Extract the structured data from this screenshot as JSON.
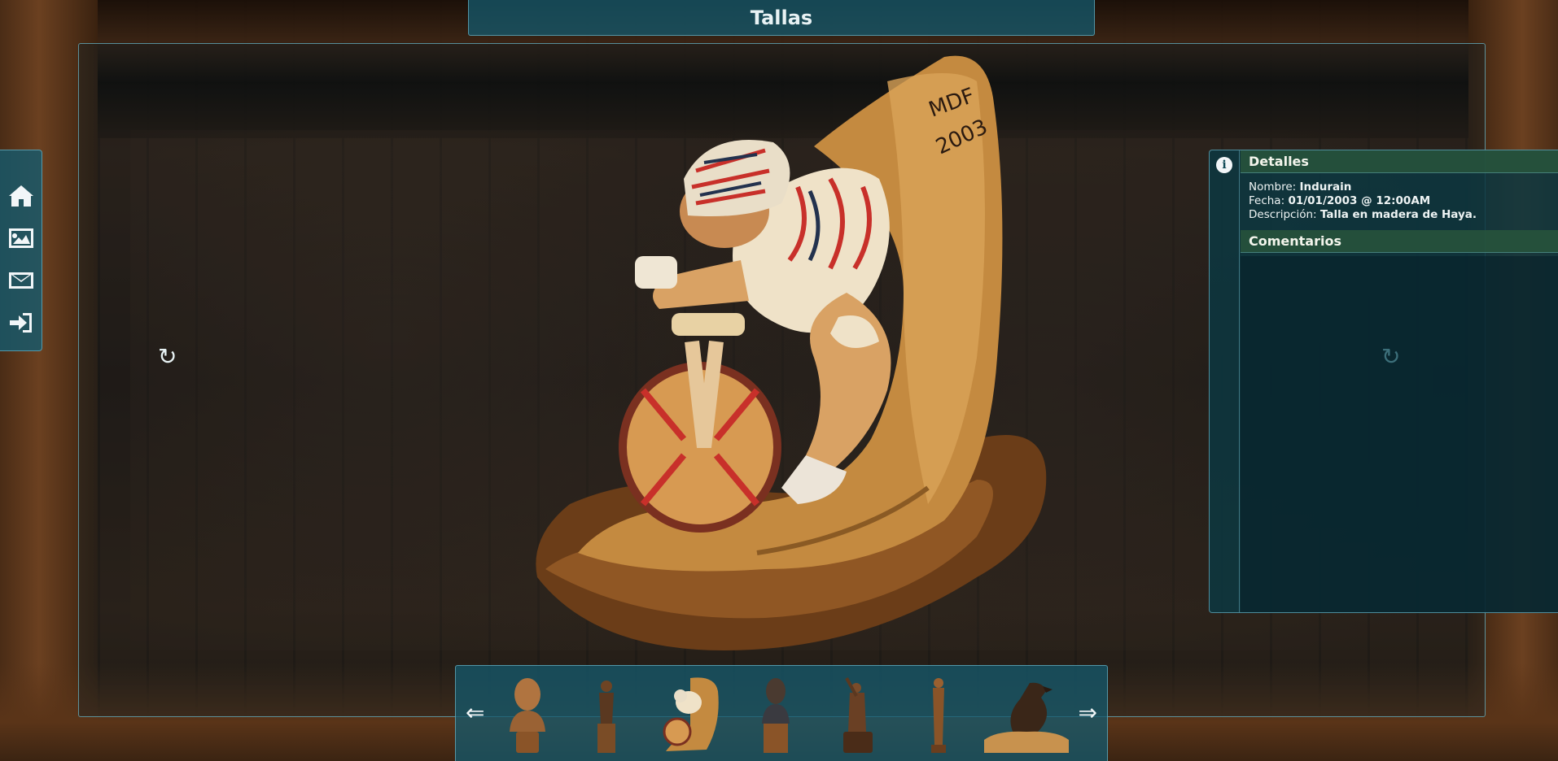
{
  "header": {
    "title": "Tallas"
  },
  "nav": {
    "items": [
      {
        "icon": "home-icon",
        "label": ""
      },
      {
        "icon": "image-icon",
        "label": ""
      },
      {
        "icon": "envelope-icon",
        "label": ""
      },
      {
        "icon": "sign-in-icon",
        "label": ""
      }
    ]
  },
  "details": {
    "title": "Detalles",
    "name_label": "Nombre:",
    "name_value": "Indurain",
    "date_label": "Fecha:",
    "date_value": "01/01/2003 @ 12:00AM",
    "desc_label": "Descripción:",
    "desc_value": "Talla en madera de Haya.",
    "comments_title": "Comentarios"
  },
  "viewer": {
    "spinner_left": "↻",
    "spinner_right": "↻"
  },
  "thumbnails": {
    "prev": "⇐",
    "next": "⇒",
    "items": [
      "bust-thumbnail",
      "standing-man-thumbnail",
      "cyclist-thumbnail",
      "bust-pedestal-thumbnail",
      "musician-thumbnail",
      "slim-figure-thumbnail",
      "eagle-thumbnail"
    ]
  },
  "image_text": {
    "signature": "MDF",
    "year": "2003"
  },
  "colors": {
    "panel": "#145a6e",
    "section_head": "#28553c",
    "accent": "#78c8dc"
  }
}
